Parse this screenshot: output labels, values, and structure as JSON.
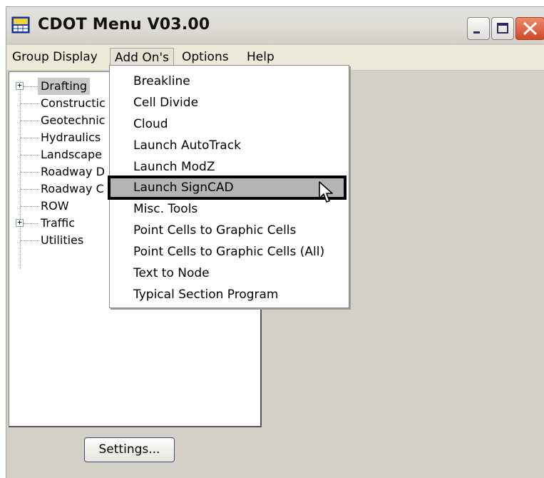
{
  "window": {
    "title": "CDOT Menu V03.00",
    "accent_close": "#d65a36"
  },
  "menubar": {
    "items": [
      "Group Display",
      "Add On's",
      "Options",
      "Help"
    ],
    "open_menu": "Add On's"
  },
  "tree": {
    "items": [
      {
        "label": "Drafting",
        "expandable": true,
        "selected": true
      },
      {
        "label": "Constructic",
        "expandable": false
      },
      {
        "label": "Geotechnic",
        "expandable": false
      },
      {
        "label": "Hydraulics",
        "expandable": false
      },
      {
        "label": "Landscape",
        "expandable": false
      },
      {
        "label": "Roadway D",
        "expandable": false
      },
      {
        "label": "Roadway C",
        "expandable": false
      },
      {
        "label": "ROW",
        "expandable": false
      },
      {
        "label": "Traffic",
        "expandable": true
      },
      {
        "label": "Utilities",
        "expandable": false
      }
    ]
  },
  "dropdown": {
    "items": [
      "Breakline",
      "Cell Divide",
      "Cloud",
      "Launch AutoTrack",
      "Launch ModZ",
      "Launch SignCAD",
      "Misc. Tools",
      "Point Cells to Graphic Cells",
      "Point Cells to Graphic Cells (All)",
      "Text to Node",
      "Typical Section Program"
    ],
    "highlighted": "Launch SignCAD"
  },
  "buttons": {
    "settings_label": "Settings..."
  }
}
